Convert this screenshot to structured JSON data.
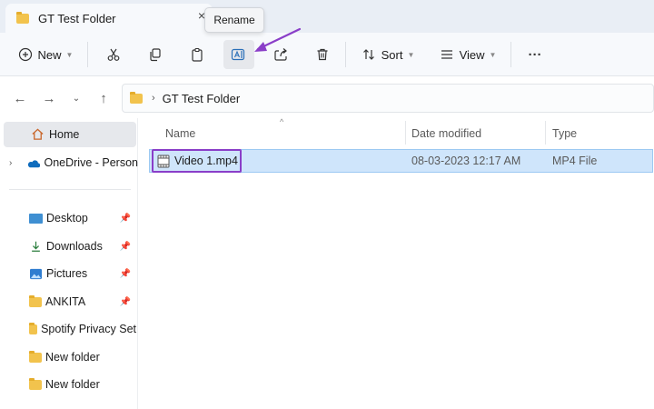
{
  "window": {
    "tab_title": "GT Test Folder",
    "tab_close": "×"
  },
  "tooltip": {
    "text": "Rename"
  },
  "toolbar": {
    "new_label": "New",
    "sort_label": "Sort",
    "view_label": "View",
    "more_label": "···"
  },
  "address": {
    "chevron": "›",
    "path": "GT Test Folder"
  },
  "sidebar": {
    "items": [
      {
        "label": "Home"
      },
      {
        "label": "OneDrive - Person"
      },
      {
        "label": "Desktop",
        "pinned": true
      },
      {
        "label": "Downloads",
        "pinned": true
      },
      {
        "label": "Pictures",
        "pinned": true
      },
      {
        "label": "ANKITA",
        "pinned": true
      },
      {
        "label": "Spotify Privacy Set"
      },
      {
        "label": "New folder"
      },
      {
        "label": "New folder"
      }
    ]
  },
  "file_list": {
    "columns": [
      "Name",
      "Date modified",
      "Type"
    ],
    "rows": [
      {
        "name": "Video 1.mp4",
        "date_modified": "08-03-2023 12:17 AM",
        "type": "MP4 File",
        "selected": true
      }
    ]
  },
  "colors": {
    "accent_annotation": "#8a3ec8",
    "selection": "#cfe5fb",
    "folder": "#f2c34d"
  }
}
